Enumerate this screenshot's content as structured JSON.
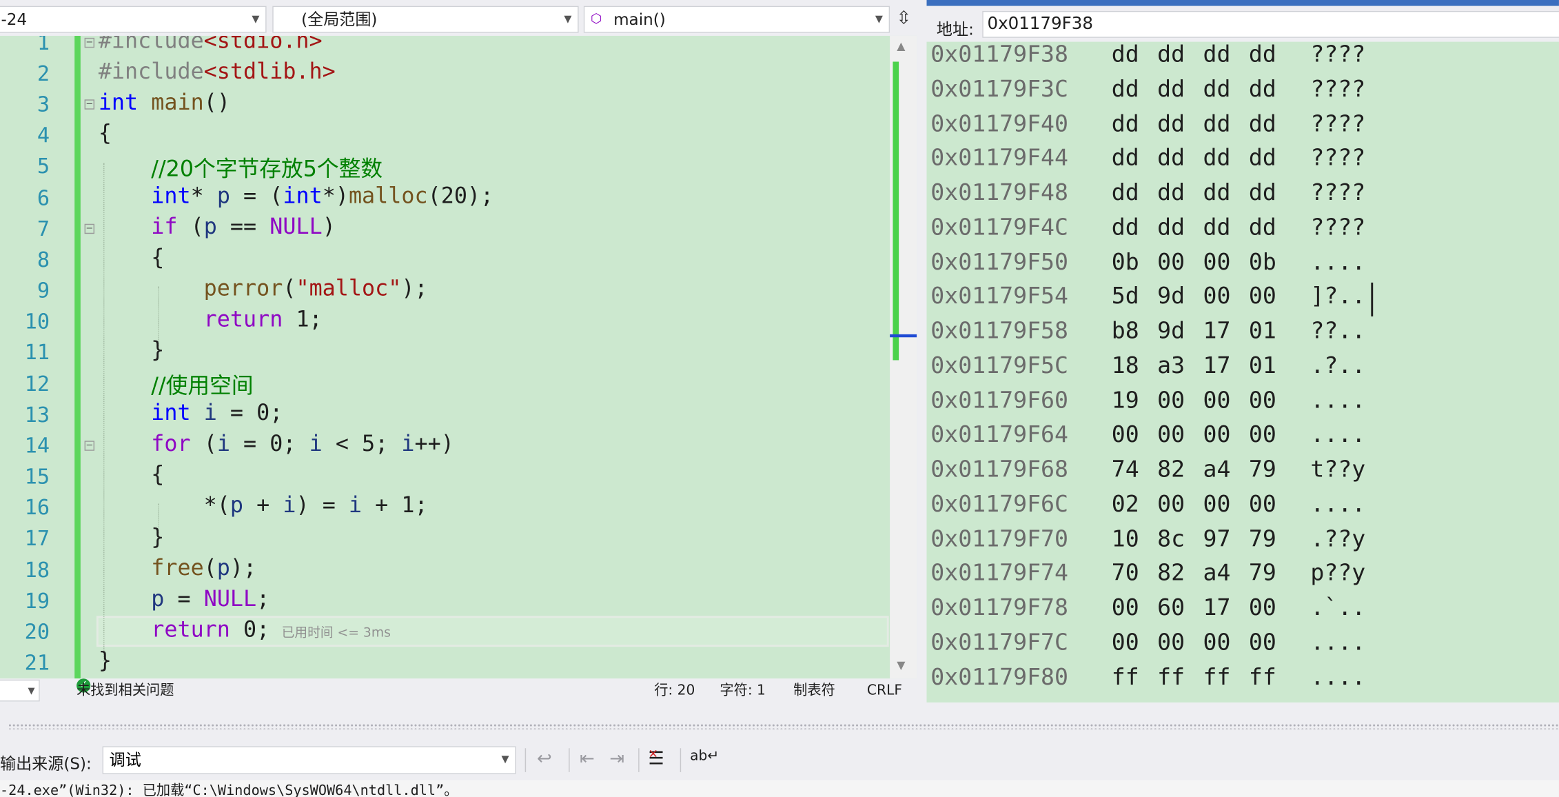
{
  "nav": {
    "project": "-24",
    "scope": "(全局范围)",
    "function": "main()"
  },
  "editor": {
    "line_numbers": [
      "1",
      "2",
      "3",
      "4",
      "5",
      "6",
      "7",
      "8",
      "9",
      "10",
      "11",
      "12",
      "13",
      "14",
      "15",
      "16",
      "17",
      "18",
      "19",
      "20",
      "21"
    ],
    "tokens": {
      "l1_pp": "#include",
      "l1_inc": "<stdio.h>",
      "l2_pp": "#include",
      "l2_inc": "<stdlib.h>",
      "l3_kw": "int",
      "l3_fn": "main",
      "l3_rest": "()",
      "l4": "{",
      "l5_cmt": "//20个字节存放5个整数",
      "l6_kw": "int",
      "l6_a": "* ",
      "l6_var": "p",
      "l6_b": " = (",
      "l6_kw2": "int",
      "l6_c": "*)",
      "l6_fn": "malloc",
      "l6_d": "(20);",
      "l7_kw": "if",
      "l7_a": " (",
      "l7_var": "p",
      "l7_b": " == ",
      "l7_null": "NULL",
      "l7_c": ")",
      "l8": "{",
      "l9_fn": "perror",
      "l9_a": "(",
      "l9_str": "\"malloc\"",
      "l9_b": ");",
      "l10_kw": "return",
      "l10_a": " 1;",
      "l11": "}",
      "l12_cmt": "//使用空间",
      "l13_kw": "int",
      "l13_a": " ",
      "l13_var": "i",
      "l13_b": " = 0;",
      "l14_kw": "for",
      "l14_a": " (",
      "l14_v1": "i",
      "l14_b": " = 0; ",
      "l14_v2": "i",
      "l14_c": " < 5; ",
      "l14_v3": "i",
      "l14_d": "++)",
      "l15": "{",
      "l16_a": "*(",
      "l16_v1": "p",
      "l16_b": " + ",
      "l16_v2": "i",
      "l16_c": ") = ",
      "l16_v3": "i",
      "l16_d": " + 1;",
      "l17": "}",
      "l18_fn": "free",
      "l18_a": "(",
      "l18_var": "p",
      "l18_b": ");",
      "l19_var": "p",
      "l19_a": " = ",
      "l19_null": "NULL",
      "l19_b": ";",
      "l20_kw": "return",
      "l20_a": " 0;",
      "l20_hint": "已用时间 <= 3ms",
      "l21": "}"
    }
  },
  "status": {
    "issues": "未找到相关问题",
    "line": "行: 20",
    "char": "字符: 1",
    "tabs": "制表符",
    "eol": "CRLF"
  },
  "memory": {
    "address_label": "地址:",
    "address_value": "0x01179F38",
    "rows": [
      {
        "addr": "0x01179F38",
        "bytes": [
          "dd",
          "dd",
          "dd",
          "dd"
        ],
        "ascii": "????"
      },
      {
        "addr": "0x01179F3C",
        "bytes": [
          "dd",
          "dd",
          "dd",
          "dd"
        ],
        "ascii": "????"
      },
      {
        "addr": "0x01179F40",
        "bytes": [
          "dd",
          "dd",
          "dd",
          "dd"
        ],
        "ascii": "????"
      },
      {
        "addr": "0x01179F44",
        "bytes": [
          "dd",
          "dd",
          "dd",
          "dd"
        ],
        "ascii": "????"
      },
      {
        "addr": "0x01179F48",
        "bytes": [
          "dd",
          "dd",
          "dd",
          "dd"
        ],
        "ascii": "????"
      },
      {
        "addr": "0x01179F4C",
        "bytes": [
          "dd",
          "dd",
          "dd",
          "dd"
        ],
        "ascii": "????"
      },
      {
        "addr": "0x01179F50",
        "bytes": [
          "0b",
          "00",
          "00",
          "0b"
        ],
        "ascii": "...."
      },
      {
        "addr": "0x01179F54",
        "bytes": [
          "5d",
          "9d",
          "00",
          "00"
        ],
        "ascii": "]?.."
      },
      {
        "addr": "0x01179F58",
        "bytes": [
          "b8",
          "9d",
          "17",
          "01"
        ],
        "ascii": "??.."
      },
      {
        "addr": "0x01179F5C",
        "bytes": [
          "18",
          "a3",
          "17",
          "01"
        ],
        "ascii": ".?.."
      },
      {
        "addr": "0x01179F60",
        "bytes": [
          "19",
          "00",
          "00",
          "00"
        ],
        "ascii": "...."
      },
      {
        "addr": "0x01179F64",
        "bytes": [
          "00",
          "00",
          "00",
          "00"
        ],
        "ascii": "...."
      },
      {
        "addr": "0x01179F68",
        "bytes": [
          "74",
          "82",
          "a4",
          "79"
        ],
        "ascii": "t??y"
      },
      {
        "addr": "0x01179F6C",
        "bytes": [
          "02",
          "00",
          "00",
          "00"
        ],
        "ascii": "...."
      },
      {
        "addr": "0x01179F70",
        "bytes": [
          "10",
          "8c",
          "97",
          "79"
        ],
        "ascii": ".??y"
      },
      {
        "addr": "0x01179F74",
        "bytes": [
          "70",
          "82",
          "a4",
          "79"
        ],
        "ascii": "p??y"
      },
      {
        "addr": "0x01179F78",
        "bytes": [
          "00",
          "60",
          "17",
          "00"
        ],
        "ascii": ".`.."
      },
      {
        "addr": "0x01179F7C",
        "bytes": [
          "00",
          "00",
          "00",
          "00"
        ],
        "ascii": "...."
      },
      {
        "addr": "0x01179F80",
        "bytes": [
          "ff",
          "ff",
          "ff",
          "ff"
        ],
        "ascii": "...."
      }
    ]
  },
  "output": {
    "source_label": "输出来源(S):",
    "source_value": "调试",
    "text": "-24.exe”(Win32): 已加载“C:\\Windows\\SysWOW64\\ntdll.dll”。"
  },
  "colors": {
    "editor_bg": "#cce8cf",
    "change_bar": "#5cd65c",
    "keyword": "#0000ff",
    "control_keyword": "#8f08c4",
    "comment": "#008000",
    "string": "#a31515"
  }
}
